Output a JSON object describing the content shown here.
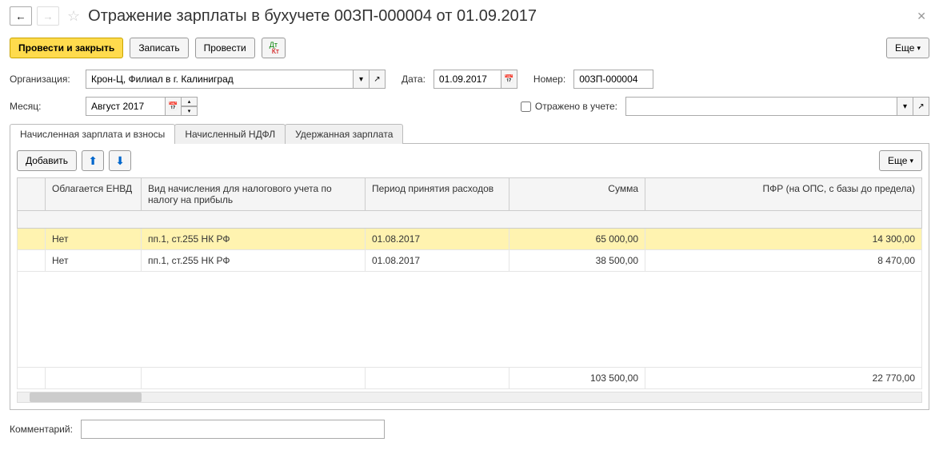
{
  "header": {
    "title": "Отражение зарплаты в бухучете 00ЗП-000004 от 01.09.2017"
  },
  "toolbar": {
    "post_and_close": "Провести и закрыть",
    "save": "Записать",
    "post": "Провести",
    "more": "Еще"
  },
  "form": {
    "org_label": "Организация:",
    "org_value": "Крон-Ц, Филиал в г. Калиниград",
    "date_label": "Дата:",
    "date_value": "01.09.2017",
    "number_label": "Номер:",
    "number_value": "00ЗП-000004",
    "month_label": "Месяц:",
    "month_value": "Август 2017",
    "reflected_label": "Отражено в учете:",
    "reflected_value": ""
  },
  "tabs": {
    "t1": "Начисленная зарплата и взносы",
    "t2": "Начисленный НДФЛ",
    "t3": "Удержанная зарплата"
  },
  "panel_toolbar": {
    "add": "Добавить",
    "more": "Еще"
  },
  "table": {
    "headers": {
      "envd": "Облагается ЕНВД",
      "type": "Вид начисления для налогового учета по налогу на прибыль",
      "period": "Период принятия расходов",
      "sum": "Сумма",
      "pfr": "ПФР (на ОПС, с базы до предела)"
    },
    "rows": [
      {
        "envd": "Нет",
        "type": "пп.1, ст.255 НК РФ",
        "period": "01.08.2017",
        "sum": "65 000,00",
        "pfr": "14 300,00"
      },
      {
        "envd": "Нет",
        "type": "пп.1, ст.255 НК РФ",
        "period": "01.08.2017",
        "sum": "38 500,00",
        "pfr": "8 470,00"
      }
    ],
    "totals": {
      "sum": "103 500,00",
      "pfr": "22 770,00"
    }
  },
  "comment_label": "Комментарий:"
}
